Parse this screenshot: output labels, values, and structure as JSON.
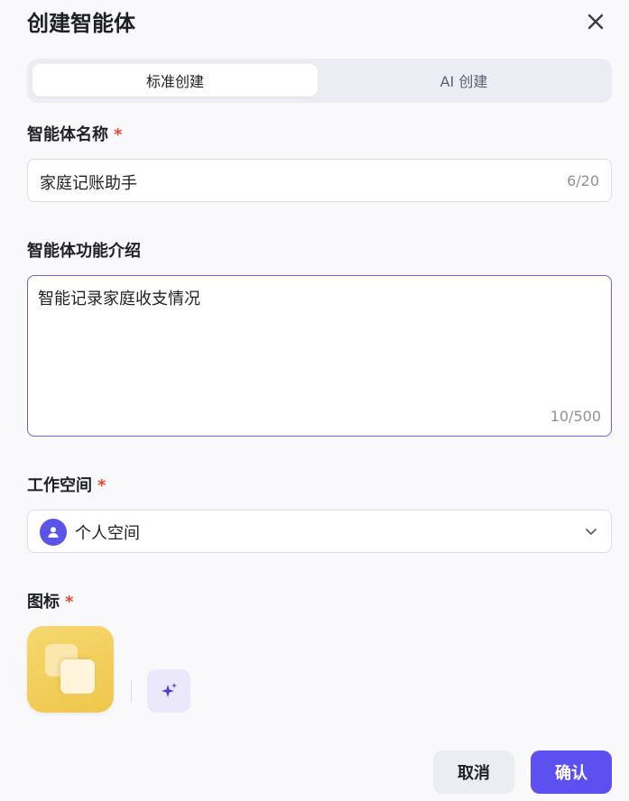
{
  "dialog": {
    "title": "创建智能体",
    "close_icon": "close-icon"
  },
  "tabs": [
    {
      "label": "标准创建",
      "active": true
    },
    {
      "label": "AI 创建",
      "active": false
    }
  ],
  "name_field": {
    "label": "智能体名称",
    "required_mark": "*",
    "value": "家庭记账助手",
    "count": "6/20"
  },
  "description_field": {
    "label": "智能体功能介绍",
    "value": "智能记录家庭收支情况",
    "count": "10/500"
  },
  "workspace_field": {
    "label": "工作空间",
    "required_mark": "*",
    "value": "个人空间",
    "avatar_icon": "user-icon",
    "dropdown_icon": "chevron-down-icon"
  },
  "icon_field": {
    "label": "图标",
    "required_mark": "*",
    "tile_color": "#efc64b",
    "ai_generate_icon": "sparkle-icon"
  },
  "footer": {
    "cancel_label": "取消",
    "confirm_label": "确认"
  },
  "colors": {
    "accent": "#5d50f0",
    "focus_border": "#6b62e6",
    "required": "#f0442d"
  }
}
